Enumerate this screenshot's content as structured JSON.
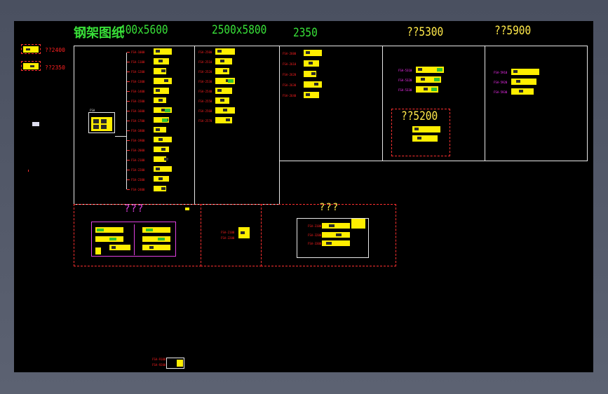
{
  "drawing": {
    "title": "钢架图纸",
    "side_labels": [
      "??2400",
      "??2350"
    ]
  },
  "headers": {
    "h1": "400x5600",
    "h2": "2500x5800",
    "h3": "2350",
    "h4": "??5300",
    "h5": "??5900",
    "h6": "??5200"
  },
  "groups": {
    "g1": [
      "FSA-1000",
      "FSA-1100",
      "FSA-1200",
      "FSA-1300",
      "FSA-1400",
      "FSA-1500",
      "FSA-1600",
      "FSA-1700",
      "FSA-1800",
      "FSA-1900",
      "FSA-2000",
      "FSA-2100",
      "FSA-2200",
      "FSA-2300",
      "FSA-2400"
    ],
    "g2": [
      "FSA-2500",
      "FSA-2510",
      "FSA-2520",
      "FSA-2530",
      "FSA-2540",
      "FSA-2550",
      "FSA-2560",
      "FSA-2570"
    ],
    "g3": [
      "FSA-2600",
      "FSA-2610",
      "FSA-2620",
      "FSA-2630",
      "FSA-2640"
    ],
    "g4": [
      "FSA-5310",
      "FSA-5320",
      "FSA-5330"
    ],
    "g5": [
      "FSA-5910",
      "FSA-5920",
      "FSA-5930"
    ],
    "g6": [
      "FSA-5210",
      "FSA-5220"
    ]
  },
  "lower": {
    "q1": "???",
    "q2": "???"
  }
}
